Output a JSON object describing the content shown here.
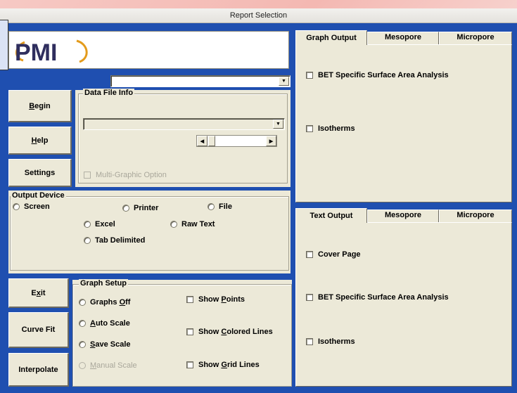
{
  "window": {
    "title": "Report Selection"
  },
  "logo": {
    "text": "PMI",
    "accent_color": "#e39b1c"
  },
  "top_combo": {
    "value": ""
  },
  "buttons": {
    "begin": {
      "pre": "",
      "key": "B",
      "post": "egin"
    },
    "help": {
      "pre": "",
      "key": "H",
      "post": "elp"
    },
    "settings": "Settings",
    "exit": {
      "pre": "E",
      "key": "x",
      "post": "it"
    },
    "curve_fit": "Curve Fit",
    "interpolate": "Interpolate"
  },
  "data_file_info": {
    "label": "Data File Info",
    "file_combo": "",
    "multi_graphic": "Multi-Graphic Option"
  },
  "output_device": {
    "label": "Output Device",
    "options": [
      "Screen",
      "Printer",
      "File",
      "Excel",
      "Raw Text",
      "Tab Delimited"
    ]
  },
  "graph_setup": {
    "label": "Graph Setup",
    "graphs_off": {
      "pre": "Graphs ",
      "key": "O",
      "post": "ff"
    },
    "auto_scale": {
      "pre": "",
      "key": "A",
      "post": "uto Scale"
    },
    "save_scale": {
      "pre": "",
      "key": "S",
      "post": "ave Scale"
    },
    "manual_scale": {
      "pre": "",
      "key": "M",
      "post": "anual Scale"
    },
    "show_points": {
      "pre": "Show ",
      "key": "P",
      "post": "oints"
    },
    "show_colored_lines": {
      "pre": "Show ",
      "key": "C",
      "post": "olored Lines"
    },
    "show_grid_lines": {
      "pre": "Show ",
      "key": "G",
      "post": "rid Lines"
    }
  },
  "graph_tabs": {
    "tabs": [
      "Graph Output",
      "Mesopore",
      "Micropore"
    ],
    "items": [
      "BET Specific Surface Area Analysis",
      "Isotherms"
    ]
  },
  "text_tabs": {
    "tabs": [
      "Text Output",
      "Mesopore",
      "Micropore"
    ],
    "items": [
      "Cover Page",
      "BET Specific Surface Area Analysis",
      "Isotherms"
    ]
  }
}
